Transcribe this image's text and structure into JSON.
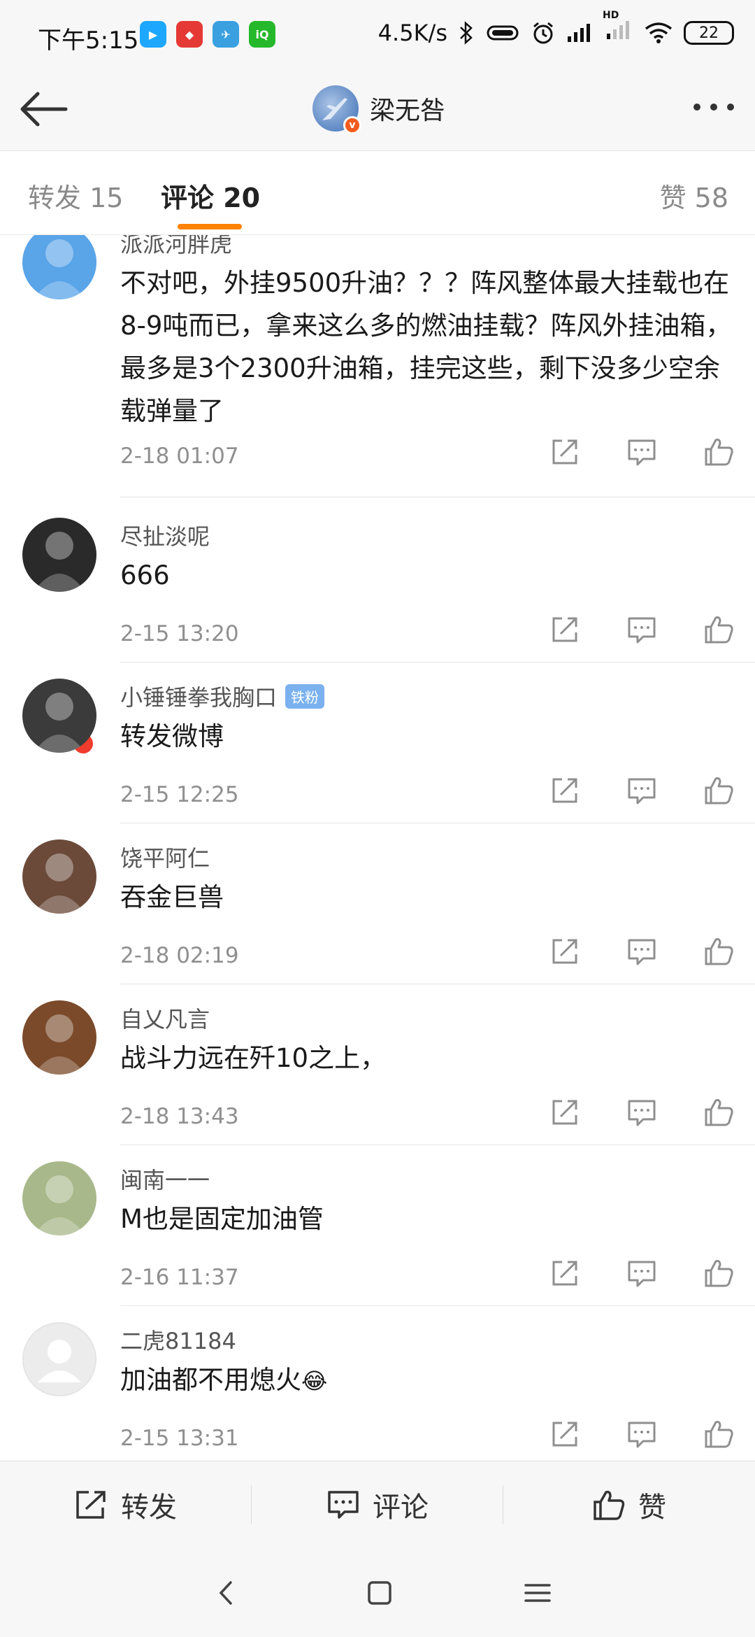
{
  "status_bar": {
    "time": "下午5:15",
    "network_speed": "4.5K/s",
    "battery": "22",
    "signal_label": "HD",
    "app_icons": [
      {
        "name": "youku-icon",
        "color": "#1ea7ff",
        "glyph": "▶"
      },
      {
        "name": "news-app-icon",
        "color": "#e53935",
        "glyph": "◆"
      },
      {
        "name": "telegram-icon",
        "color": "#3aa0e0",
        "glyph": "✈"
      },
      {
        "name": "iqiyi-icon",
        "color": "#25b82a",
        "glyph": "iQ"
      }
    ]
  },
  "header": {
    "title": "梁无咎"
  },
  "tabs": [
    {
      "label": "转发 15",
      "active": false
    },
    {
      "label": "评论 20",
      "active": true
    },
    {
      "label": "赞 58",
      "active": false
    }
  ],
  "comments": [
    {
      "user": "派派河胖虎",
      "badge": "",
      "text": "不对吧，外挂9500升油？？？阵风整体最大挂载也在8-9吨而已，拿来这么多的燃油挂载？阵风外挂油箱，最多是3个2300升油箱，挂完这些，剩下没多少空余载弹量了",
      "time": "2-18 01:07",
      "avatar_color": "#5aa4e8"
    },
    {
      "user": "尽扯淡呢",
      "badge": "",
      "text": "666",
      "time": "2-15 13:20",
      "avatar_color": "#2a2a2a"
    },
    {
      "user": "小锤锤拳我胸口",
      "badge": "铁粉",
      "text": "转发微博",
      "time": "2-15 12:25",
      "avatar_color": "#3b3b3b"
    },
    {
      "user": "饶平阿仁",
      "badge": "",
      "text": "吞金巨兽",
      "time": "2-18 02:19",
      "avatar_color": "#6b4a3a"
    },
    {
      "user": "自乂凡言",
      "badge": "",
      "text": "战斗力远在歼10之上，",
      "time": "2-18 13:43",
      "avatar_color": "#7a4a2a"
    },
    {
      "user": "闽南一一",
      "badge": "",
      "text": "M也是固定加油管",
      "time": "2-16 11:37",
      "avatar_color": "#a8b88a"
    },
    {
      "user": "二虎81184",
      "badge": "",
      "text": "加油都不用熄火",
      "emoji": "😂",
      "time": "2-15 13:31",
      "avatar_color": "#e6e6e6"
    }
  ],
  "bottom_bar": {
    "repost": "转发",
    "comment": "评论",
    "like": "赞"
  },
  "colors": {
    "accent": "#ff8200",
    "fan_badge": "#7ab1ee"
  }
}
